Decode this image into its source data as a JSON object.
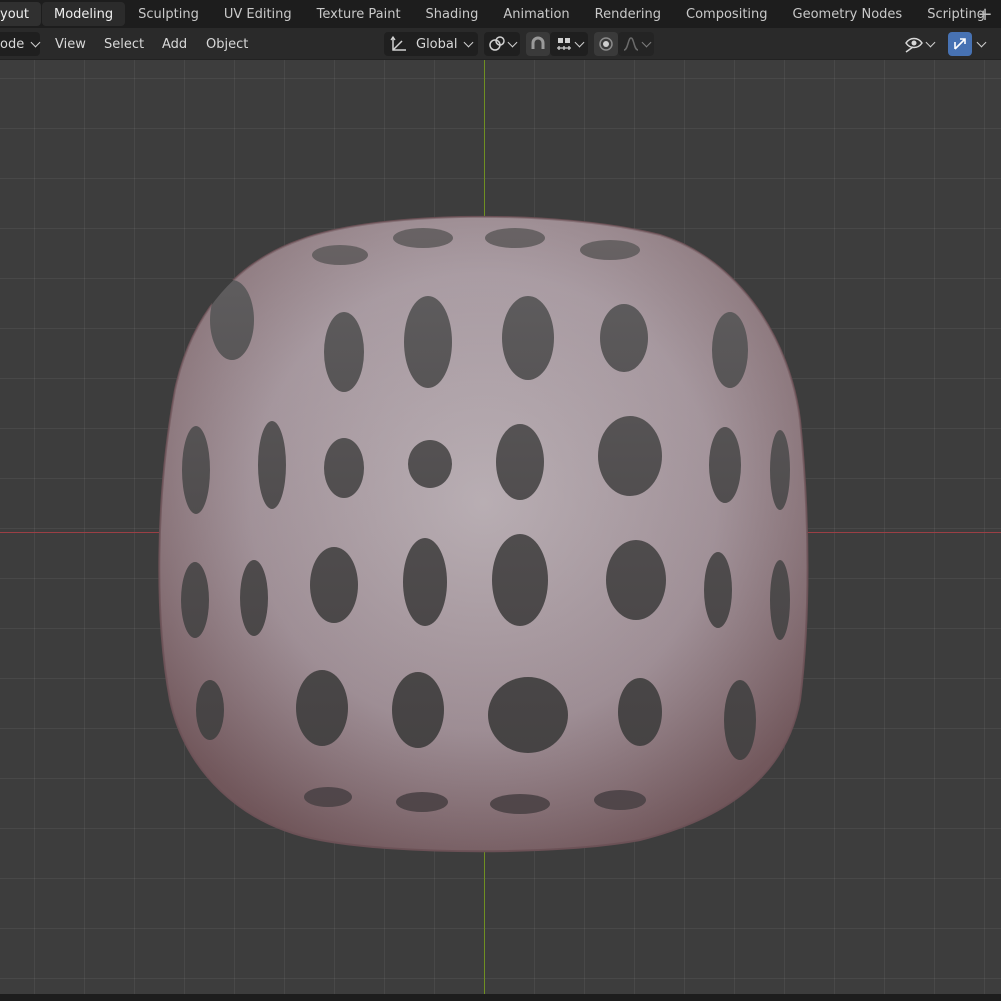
{
  "workspace_tabs": [
    {
      "label": "yout",
      "active": true
    },
    {
      "label": "Modeling"
    },
    {
      "label": "Sculpting"
    },
    {
      "label": "UV Editing"
    },
    {
      "label": "Texture Paint"
    },
    {
      "label": "Shading"
    },
    {
      "label": "Animation"
    },
    {
      "label": "Rendering"
    },
    {
      "label": "Compositing"
    },
    {
      "label": "Geometry Nodes"
    },
    {
      "label": "Scripting"
    }
  ],
  "add_workspace_icon": "plus-icon",
  "toolbar": {
    "mode_label": "ode",
    "menu": [
      "View",
      "Select",
      "Add",
      "Object"
    ],
    "transform_orientation": "Global",
    "icons": {
      "orientation": "transform-orientation-icon",
      "pivot": "pivot-point-icon",
      "snap": "snap-magnet-icon",
      "snap_target": "snap-increment-icon",
      "proportional": "proportional-editing-icon",
      "falloff": "falloff-curve-icon",
      "visibility": "eye-visibility-icon",
      "gizmo": "gizmo-icon"
    }
  },
  "viewport": {
    "object": "lattice-wireframe-mesh",
    "x_axis_color": "#9b3f45",
    "y_axis_color": "#6f8f22"
  },
  "colors": {
    "accent_blue": "#4772b3",
    "header_bg": "#2a2a2a",
    "tabs_bg": "#1d1d1d",
    "viewport_bg": "#3d3d3d"
  }
}
